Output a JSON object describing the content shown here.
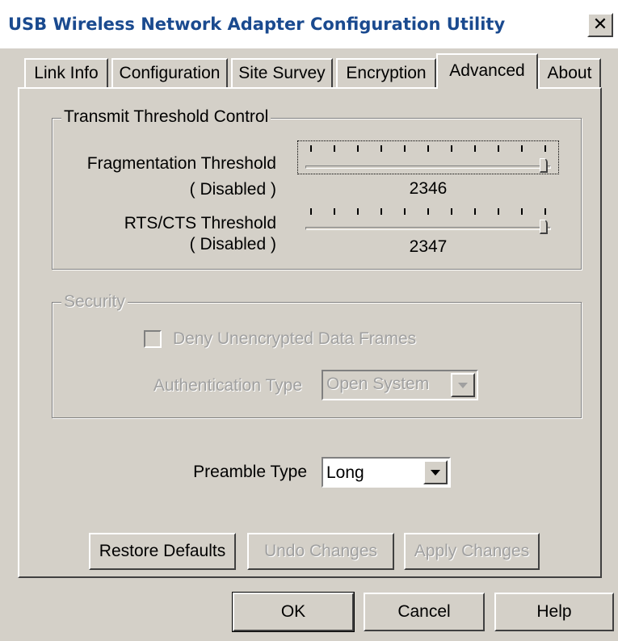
{
  "window": {
    "title": "USB Wireless Network Adapter Configuration Utility",
    "close_glyph": "✕"
  },
  "tabs": [
    {
      "label": "Link Info",
      "active": false
    },
    {
      "label": "Configuration",
      "active": false
    },
    {
      "label": "Site Survey",
      "active": false
    },
    {
      "label": "Encryption",
      "active": false
    },
    {
      "label": "Advanced",
      "active": true
    },
    {
      "label": "About",
      "active": false
    }
  ],
  "transmit": {
    "legend": "Transmit Threshold Control",
    "fragmentation": {
      "label": "Fragmentation Threshold",
      "status": "( Disabled )",
      "value_text": "2346",
      "level": 1.0
    },
    "rts": {
      "label": "RTS/CTS Threshold",
      "status": "( Disabled )",
      "value_text": "2347",
      "level": 1.0
    }
  },
  "security": {
    "legend": "Security",
    "deny_checkbox_label": "Deny Unencrypted Data Frames",
    "deny_checked": false,
    "auth_label": "Authentication Type",
    "auth_value": "Open System"
  },
  "preamble": {
    "label": "Preamble Type",
    "value": "Long"
  },
  "actions": {
    "restore": "Restore Defaults",
    "undo": "Undo Changes",
    "apply": "Apply Changes"
  },
  "dialog_buttons": {
    "ok": "OK",
    "cancel": "Cancel",
    "help": "Help"
  },
  "icons": {
    "close": "close-icon",
    "dropdown": "chevron-down-icon"
  }
}
